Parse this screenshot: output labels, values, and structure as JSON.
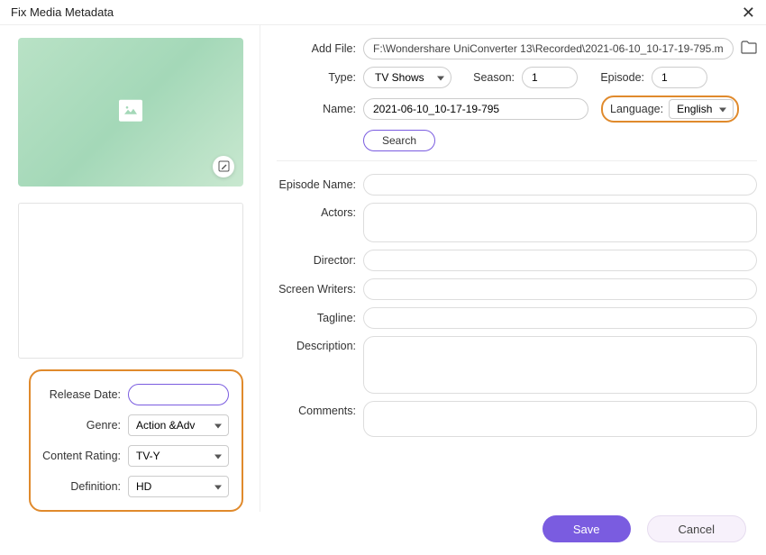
{
  "window": {
    "title": "Fix Media Metadata"
  },
  "labels": {
    "addFile": "Add File:",
    "type": "Type:",
    "season": "Season:",
    "episode": "Episode:",
    "name": "Name:",
    "language": "Language:",
    "search": "Search",
    "episodeName": "Episode Name:",
    "actors": "Actors:",
    "director": "Director:",
    "screenWriters": "Screen Writers:",
    "tagline": "Tagline:",
    "description": "Description:",
    "comments": "Comments:",
    "releaseDate": "Release Date:",
    "genre": "Genre:",
    "contentRating": "Content Rating:",
    "definition": "Definition:",
    "save": "Save",
    "cancel": "Cancel"
  },
  "values": {
    "filePath": "F:\\Wondershare UniConverter 13\\Recorded\\2021-06-10_10-17-19-795.m",
    "type": "TV Shows",
    "season": "1",
    "episode": "1",
    "name": "2021-06-10_10-17-19-795",
    "language": "English",
    "genre": "Action &Adv",
    "contentRating": "TV-Y",
    "definition": "HD",
    "releaseDate": "",
    "episodeName": "",
    "actors": "",
    "director": "",
    "screenWriters": "",
    "tagline": "",
    "description": "",
    "comments": ""
  }
}
